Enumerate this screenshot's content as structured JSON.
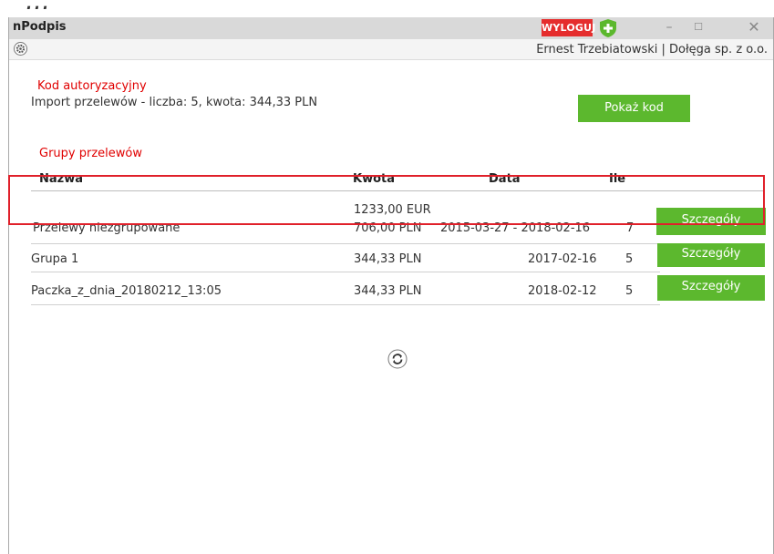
{
  "app": {
    "title": "nPodpis",
    "logout_label": "WYLOGUJ",
    "minimize_glyph": "–",
    "maximize_glyph": "☐",
    "close_glyph": "✕"
  },
  "user": {
    "info": "Ernest Trzebiatowski  |  Dołęga sp. z o.o."
  },
  "auth": {
    "heading": "Kod autoryzacyjny",
    "description": "Import przelewów - liczba: 5, kwota: 344,33 PLN",
    "show_code_label": "Pokaż kod"
  },
  "groups": {
    "heading": "Grupy przelewów",
    "columns": {
      "name": "Nazwa",
      "amount": "Kwota",
      "date": "Data",
      "count": "Ile"
    },
    "details_label": "Szczegóły",
    "rows": [
      {
        "name": "Przelewy niezgrupowane",
        "amount_line1": "1233,00 EUR",
        "amount_line2": "706,00 PLN",
        "date": "2015-03-27 - 2018-02-16",
        "count": "7"
      },
      {
        "name": "Grupa 1",
        "amount_line1": "344,33 PLN",
        "date": "2017-02-16",
        "count": "5"
      },
      {
        "name": "Paczka_z_dnia_20180212_13:05",
        "amount_line1": "344,33 PLN",
        "date": "2018-02-12",
        "count": "5"
      }
    ]
  },
  "colors": {
    "accent_green": "#5cb82e",
    "logout_red": "#e52d2d",
    "heading_red": "#e00000",
    "highlight_red": "#e0202a"
  },
  "icons": [
    "settings-gear-icon",
    "shield-icon",
    "refresh-icon"
  ]
}
